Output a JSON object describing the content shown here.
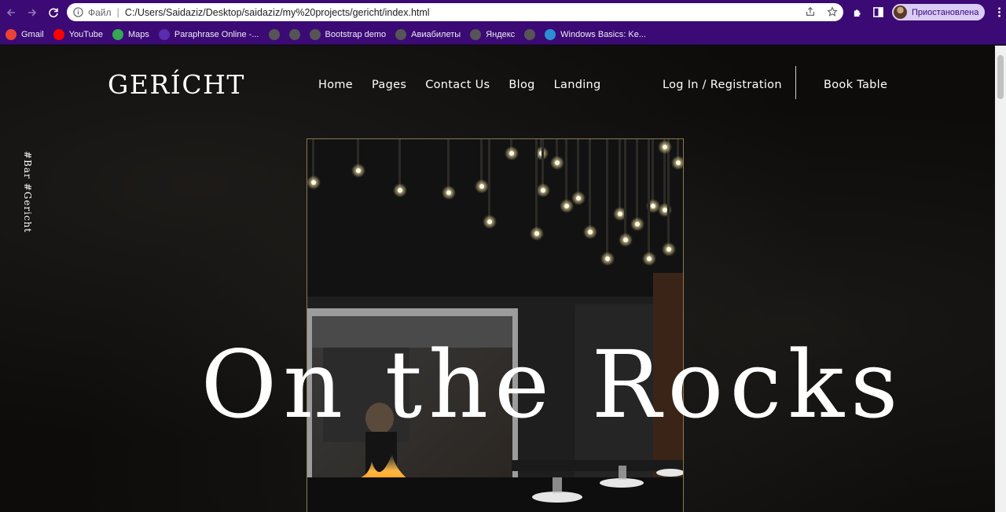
{
  "browser": {
    "omnibox": {
      "label": "Файл",
      "url": "C:/Users/Saidaziz/Desktop/saidaziz/my%20projects/gericht/index.html"
    },
    "profile": {
      "status": "Приостановлена"
    },
    "bookmarks": [
      {
        "label": "Gmail",
        "icon": "gmail-icon",
        "color": "#ea4335"
      },
      {
        "label": "YouTube",
        "icon": "youtube-icon",
        "color": "#ff0000"
      },
      {
        "label": "Maps",
        "icon": "maps-icon",
        "color": "#34a853"
      },
      {
        "label": "Paraphrase Online -...",
        "icon": "paraphrase-icon",
        "color": "#5b2bb0"
      },
      {
        "label": "",
        "icon": "globe-icon",
        "color": "#555555"
      },
      {
        "label": "",
        "icon": "globe-icon",
        "color": "#555555"
      },
      {
        "label": "Bootstrap demo",
        "icon": "globe-icon",
        "color": "#555555"
      },
      {
        "label": "Авиабилеты",
        "icon": "globe-icon",
        "color": "#555555"
      },
      {
        "label": "Яндекс",
        "icon": "globe-icon",
        "color": "#555555"
      },
      {
        "label": "",
        "icon": "globe-icon",
        "color": "#555555"
      },
      {
        "label": "Windows Basics: Ke...",
        "icon": "gcf-icon",
        "color": "#2b8fd6"
      }
    ]
  },
  "site": {
    "logo": "GERÍCHT",
    "nav": [
      "Home",
      "Pages",
      "Contact Us",
      "Blog",
      "Landing"
    ],
    "login": "Log In / Registration",
    "book_table": "Book Table",
    "side_tag": "#Bar #Gericht",
    "hero_title": "On the Rocks"
  },
  "colors": {
    "chrome": "#3b0a75",
    "page_bg": "#0d0c0b",
    "frame_gold": "#8a7a52"
  }
}
